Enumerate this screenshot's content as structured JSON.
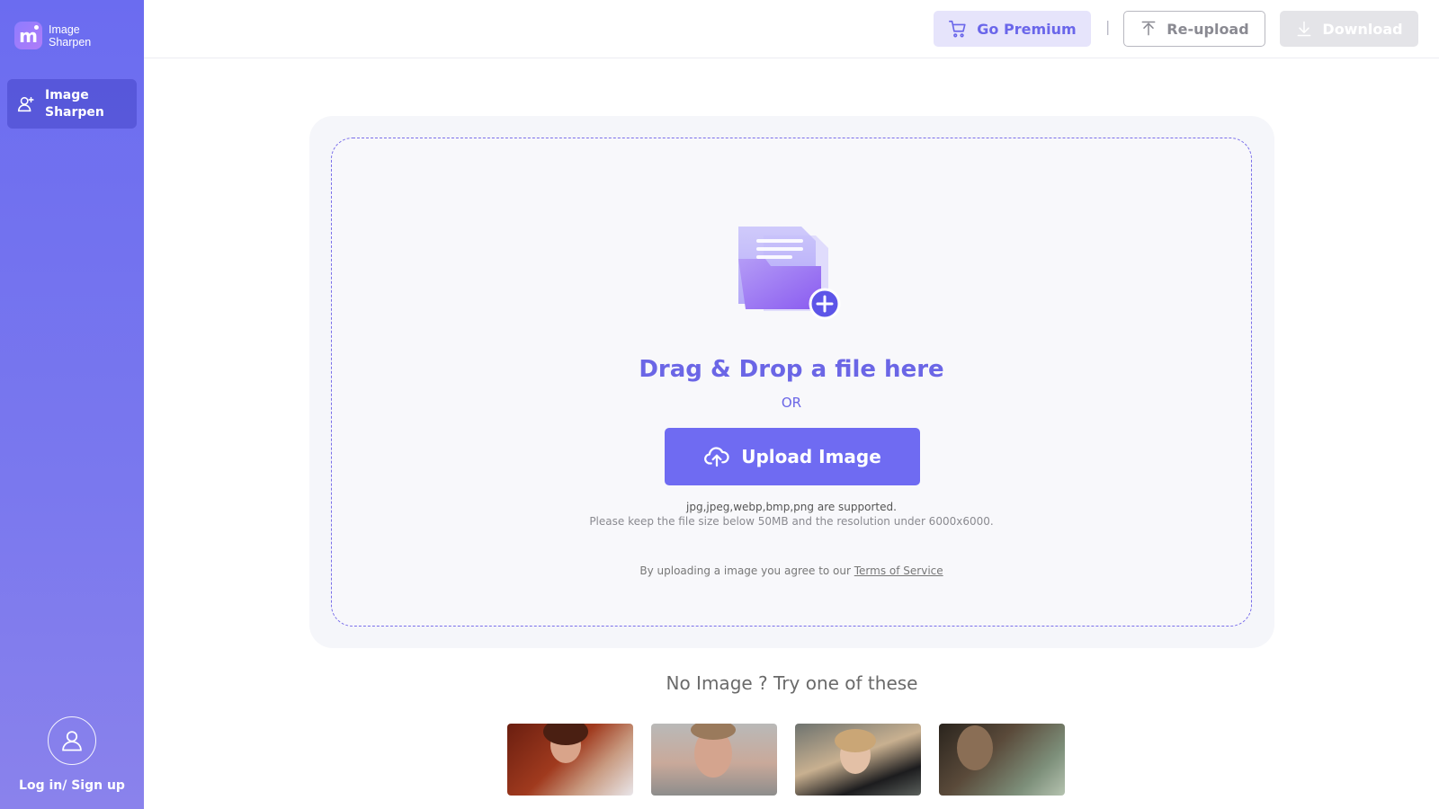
{
  "app": {
    "name_line1": "Image",
    "name_line2": "Sharpen"
  },
  "sidebar": {
    "nav": [
      {
        "label_line1": "Image",
        "label_line2": "Sharpen",
        "icon": "user-plus-icon",
        "active": true
      }
    ],
    "login_label": "Log in/ Sign up"
  },
  "header": {
    "premium_label": "Go Premium",
    "divider": "|",
    "reupload_label": "Re-upload",
    "download_label": "Download"
  },
  "upload": {
    "title": "Drag & Drop a file here",
    "or": "OR",
    "button_label": "Upload Image",
    "supported": "jpg,jpeg,webp,bmp,png are supported.",
    "limits": "Please keep the file size below 50MB and the resolution under 6000x6000.",
    "terms_prefix": "By uploading a image you agree to our ",
    "terms_link": "Terms of Service"
  },
  "samples": {
    "title": "No Image ? Try one of these",
    "items": [
      "sample-1",
      "sample-2",
      "sample-3",
      "sample-4"
    ]
  },
  "colors": {
    "accent": "#6f6bf2",
    "sidebar_top": "#6b6cf0",
    "sidebar_bottom": "#8a82ec",
    "premium_bg": "#e6e4fb"
  }
}
